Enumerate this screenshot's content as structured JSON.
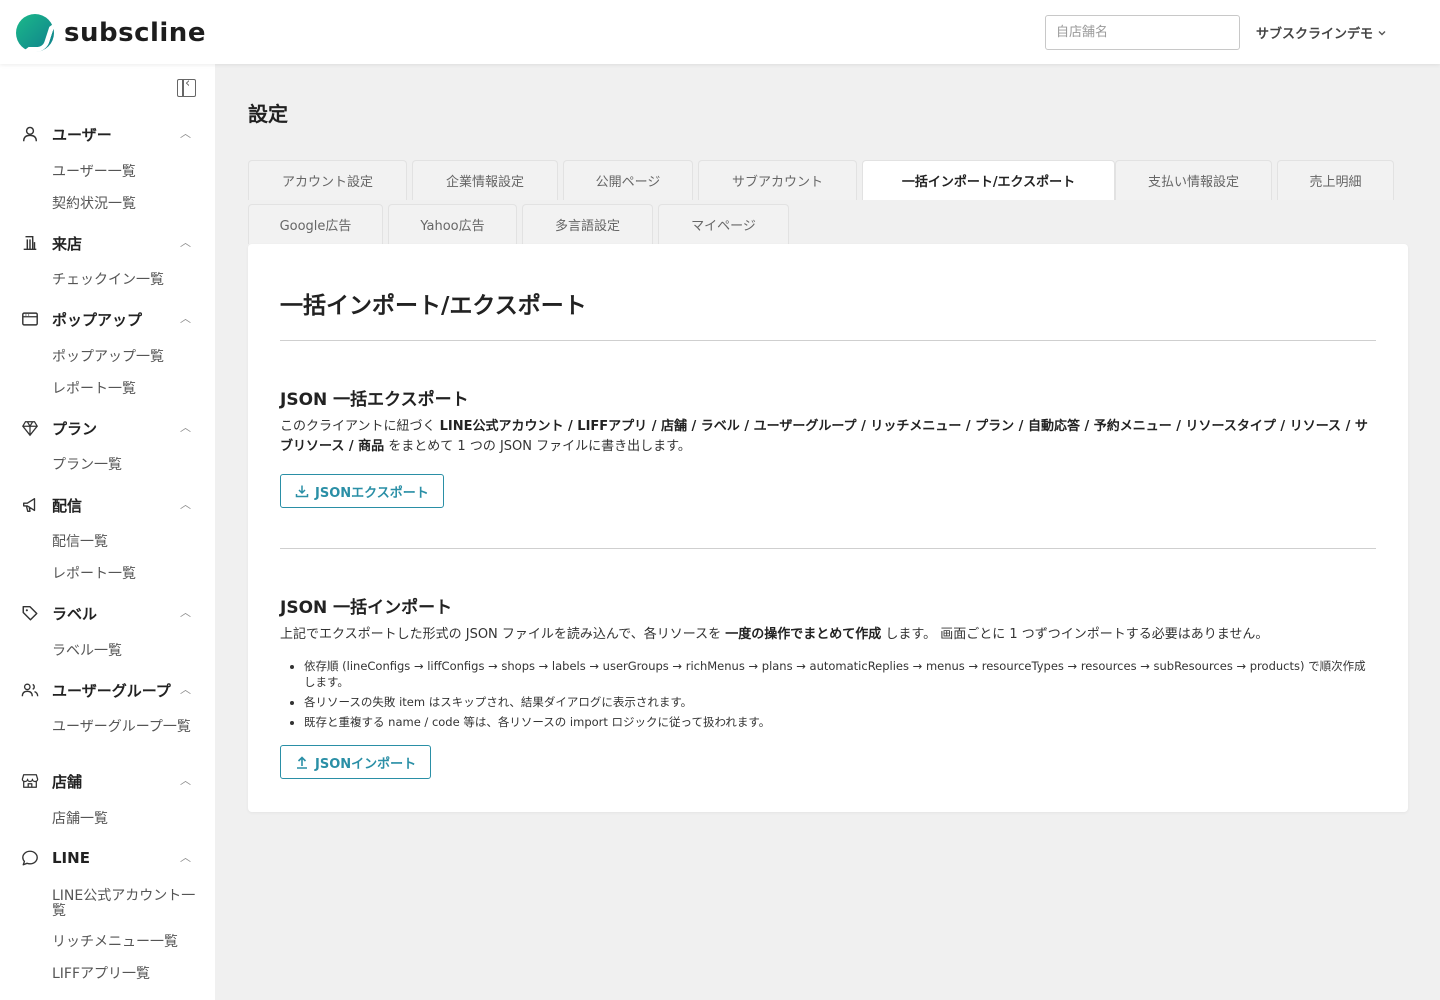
{
  "header": {
    "logo_text": "subscline",
    "shop_search_placeholder": "自店舗名",
    "account_name": "サブスクラインデモ"
  },
  "sidebar": {
    "groups": [
      {
        "label": "ユーザー",
        "icon": "user-icon",
        "items": [
          "ユーザー一覧",
          "契約状況一覧"
        ]
      },
      {
        "label": "来店",
        "icon": "building-icon",
        "items": [
          "チェックイン一覧"
        ]
      },
      {
        "label": "ポップアップ",
        "icon": "window-icon",
        "items": [
          "ポップアップ一覧",
          "レポート一覧"
        ]
      },
      {
        "label": "プラン",
        "icon": "diamond-icon",
        "items": [
          "プラン一覧"
        ]
      },
      {
        "label": "配信",
        "icon": "megaphone-icon",
        "items": [
          "配信一覧",
          "レポート一覧"
        ]
      },
      {
        "label": "ラベル",
        "icon": "tag-icon",
        "items": [
          "ラベル一覧"
        ]
      },
      {
        "label": "ユーザーグループ",
        "icon": "users-icon",
        "items": [
          "ユーザーグループ一覧"
        ]
      },
      {
        "label": "店舗",
        "icon": "store-icon",
        "items": [
          "店舗一覧"
        ]
      },
      {
        "label": "LINE",
        "icon": "chat-icon",
        "items": [
          "LINE公式アカウント一覧",
          "リッチメニュー一覧",
          "LIFFアプリ一覧"
        ]
      }
    ]
  },
  "main": {
    "page_title": "設定",
    "tabs_row1": [
      "アカウント設定",
      "企業情報設定",
      "公開ページ",
      "サブアカウント",
      "一括インポート/エクスポート",
      "支払い情報設定",
      "売上明細"
    ],
    "tabs_row2": [
      "Google広告",
      "Yahoo広告",
      "多言語設定",
      "マイページ"
    ],
    "active_tab": "一括インポート/エクスポート",
    "panel_title": "一括インポート/エクスポート",
    "export": {
      "title": "JSON 一括エクスポート",
      "desc_prefix": "このクライアントに紐づく ",
      "desc_bold": "LINE公式アカウント / LIFFアプリ / 店舗 / ラベル / ユーザーグループ / リッチメニュー / プラン / 自動応答 / 予約メニュー / リソースタイプ / リソース / サブリソース / 商品",
      "desc_suffix": " をまとめて 1 つの JSON ファイルに書き出します。",
      "button_label": "JSONエクスポート"
    },
    "import": {
      "title": "JSON 一括インポート",
      "desc_prefix": "上記でエクスポートした形式の JSON ファイルを読み込んで、各リソースを ",
      "desc_bold": "一度の操作でまとめて作成",
      "desc_suffix": " します。 画面ごとに 1 つずつインポートする必要はありません。",
      "bullets": [
        "依存順 (lineConfigs → liffConfigs → shops → labels → userGroups → richMenus → plans → automaticReplies → menus → resourceTypes → resources → subResources → products) で順次作成します。",
        "各リソースの失敗 item はスキップされ、結果ダイアログに表示されます。",
        "既存と重複する name / code 等は、各リソースの import ロジックに従って扱われます。"
      ],
      "button_label": "JSONインポート"
    }
  }
}
